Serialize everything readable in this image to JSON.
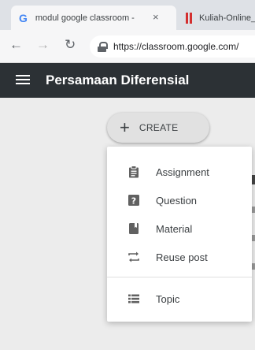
{
  "browser": {
    "tabs": [
      {
        "label": "modul google classroom -",
        "icon": "google-icon"
      },
      {
        "label": "Kuliah-Online_",
        "icon": "site-logo-icon"
      }
    ],
    "close_symbol": "×",
    "url": "https://classroom.google.com/",
    "nav_icons": [
      "back-arrow-icon",
      "forward-arrow-icon",
      "reload-icon",
      "lock-icon"
    ]
  },
  "app": {
    "title": "Persamaan Diferensial",
    "menu_icon": "hamburger-icon",
    "create_button": {
      "icon": "plus-icon",
      "label": "CREATE"
    }
  },
  "create_menu": {
    "items": [
      {
        "label": "Assignment",
        "icon": "assignment-icon"
      },
      {
        "label": "Question",
        "icon": "question-icon"
      },
      {
        "label": "Material",
        "icon": "material-icon"
      },
      {
        "label": "Reuse post",
        "icon": "reuse-icon"
      },
      {
        "label": "Topic",
        "icon": "topic-icon"
      }
    ]
  },
  "colors": {
    "header_bg": "#2c3135",
    "icon_gray": "#616161",
    "page_bg": "#ececec"
  }
}
